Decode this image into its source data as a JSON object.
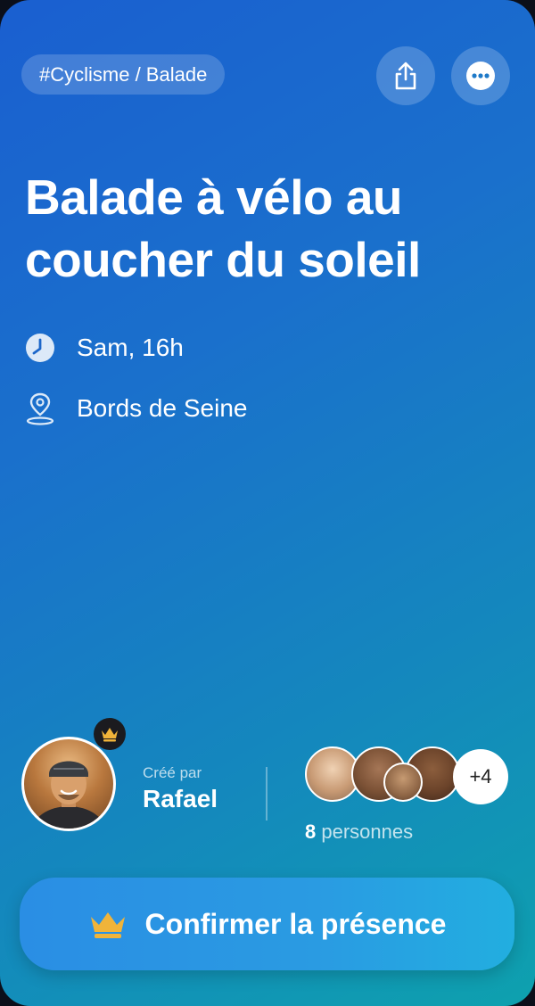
{
  "header": {
    "tag": "#Cyclisme / Balade",
    "actions": {
      "share_icon": "share-icon",
      "more_icon": "more-icon"
    }
  },
  "event": {
    "title_line1": "Balade à vélo au",
    "title_line2": "coucher du soleil",
    "time": "Sam, 16h",
    "place": "Bords de Seine",
    "icons": {
      "time": "clock-icon",
      "place": "location-pin-icon"
    }
  },
  "creator": {
    "label": "Créé par",
    "name": "Rafael",
    "badge_icon": "crown-icon"
  },
  "attendees": {
    "extra_count": "+4",
    "count_number": "8",
    "count_label": " personnes"
  },
  "cta": {
    "label": "Confirmer la présence",
    "icon": "crown-icon"
  },
  "colors": {
    "background_start": "#1a5fd0",
    "background_end": "#0ea1ae",
    "crown": "#f0b43a",
    "text": "#ffffff"
  }
}
